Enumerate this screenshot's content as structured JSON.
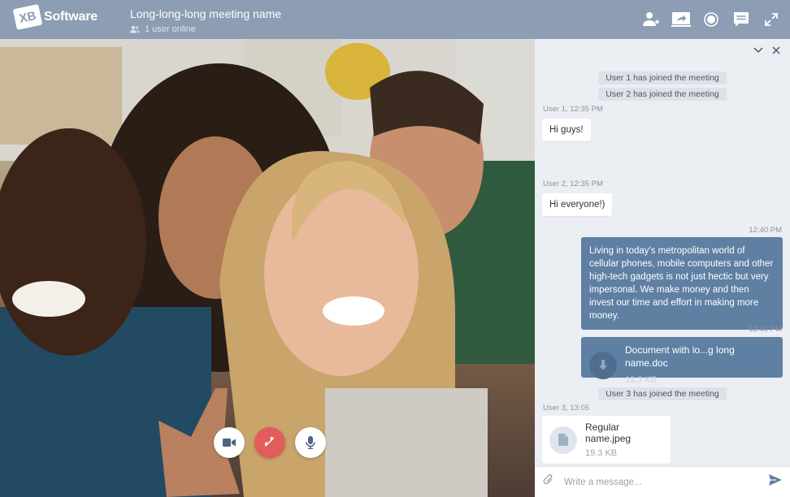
{
  "header": {
    "logo_badge": "XB",
    "logo_text": "Software",
    "meeting_name": "Long-long-long meeting name",
    "online_status": "1 user online",
    "icons": [
      "add-user-icon",
      "share-screen-icon",
      "record-icon",
      "chat-icon",
      "fullscreen-icon"
    ]
  },
  "call_controls": {
    "icons": [
      "camera-icon",
      "hang-up-icon",
      "microphone-icon"
    ],
    "hang_up_color": "#e35c5c"
  },
  "chat": {
    "messages": {
      "sys1": "User 1 has joined the meeting",
      "sys2": "User 2 has joined the meeting",
      "meta1": "User 1, 12:35 PM",
      "msg1": "Hi guys!",
      "meta2": "User 2, 12:35 PM",
      "msg2": "Hi everyone!)",
      "meta3": "12:40 PM",
      "msg3": "Living in today's metropolitan world of cellular phones, mobile computers and other high-tech gadgets is not just hectic but very impersonal. We make money and then invest our time and effort in making more money.",
      "meta4": "12:40 PM",
      "file1_name": "Document with lo...g long name.doc",
      "file1_size": "19.3 KB",
      "sys3": "User 3 has joined the meeting",
      "meta5": "User 3, 13:05",
      "file2_name": "Regular name.jpeg",
      "file2_size": "19.3 KB"
    },
    "composer": {
      "placeholder": "Write a message..."
    },
    "colors": {
      "outgoing": "#5f7fa3",
      "header": "#8c9db4"
    }
  }
}
